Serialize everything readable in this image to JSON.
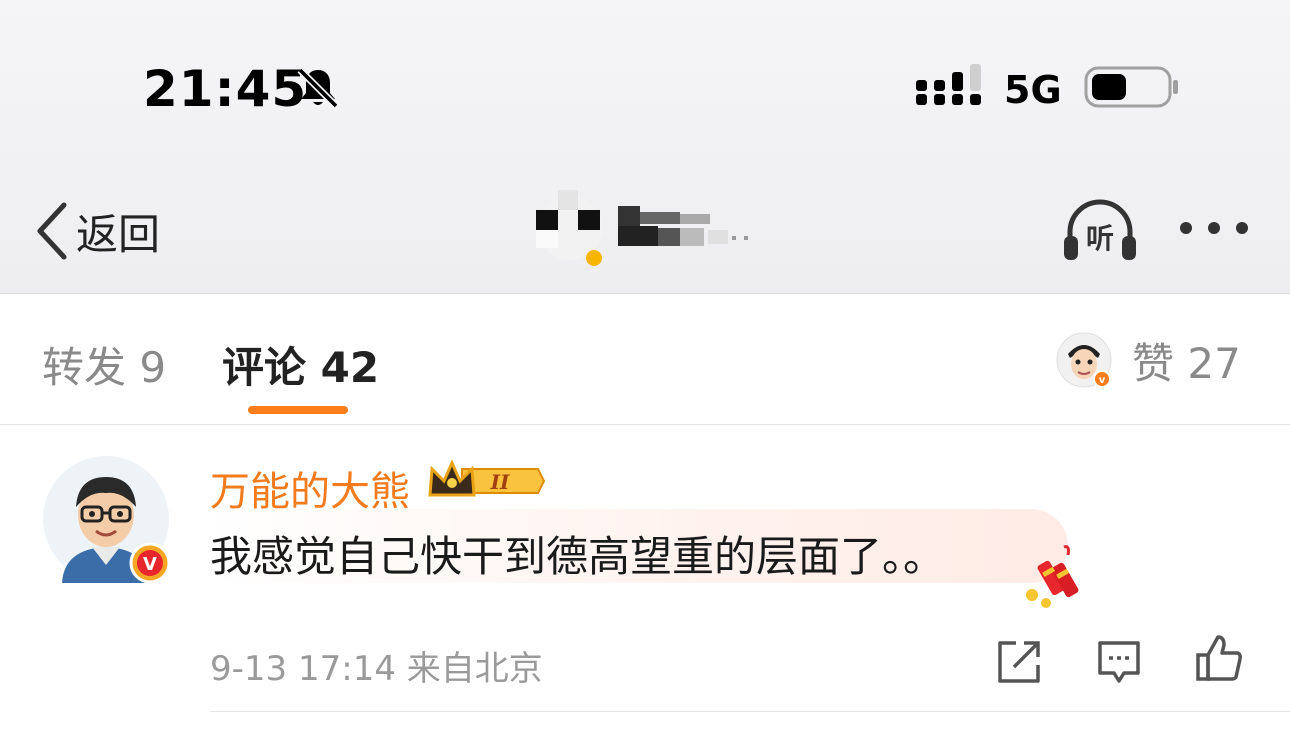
{
  "status_bar": {
    "time": "21:45",
    "network": "5G"
  },
  "nav": {
    "back_label": "返回",
    "listen_label": "听"
  },
  "tabs": {
    "reposts": "转发 9",
    "comments": "评论 42",
    "likes": "赞 27"
  },
  "comment": {
    "username": "万能的大熊",
    "vip_level": "II",
    "verified_mark": "V",
    "text": "我感觉自己快干到德高望重的层面了。。",
    "meta": "9-13 17:14  来自北京"
  },
  "colors": {
    "accent": "#ff7e1a",
    "username": "#f37b1d",
    "bubble": "#ffebe6"
  }
}
